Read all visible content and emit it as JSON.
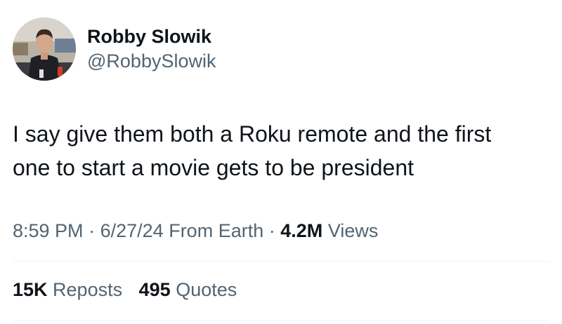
{
  "author": {
    "display_name": "Robby Slowik",
    "handle": "@RobbySlowik"
  },
  "tweet": {
    "text_line1": "I say give them both a Roku remote and the first",
    "text_line2": "one to start a movie gets to be president"
  },
  "meta": {
    "time": "8:59 PM",
    "separator": "·",
    "date": "6/27/24",
    "source": "From Earth",
    "views_count": "4.2M",
    "views_label": "Views"
  },
  "stats": {
    "reposts_count": "15K",
    "reposts_label": "Reposts",
    "quotes_count": "495",
    "quotes_label": "Quotes"
  },
  "colors": {
    "primary_text": "#0f1419",
    "secondary_text": "#536471",
    "divider": "#eff3f4"
  }
}
